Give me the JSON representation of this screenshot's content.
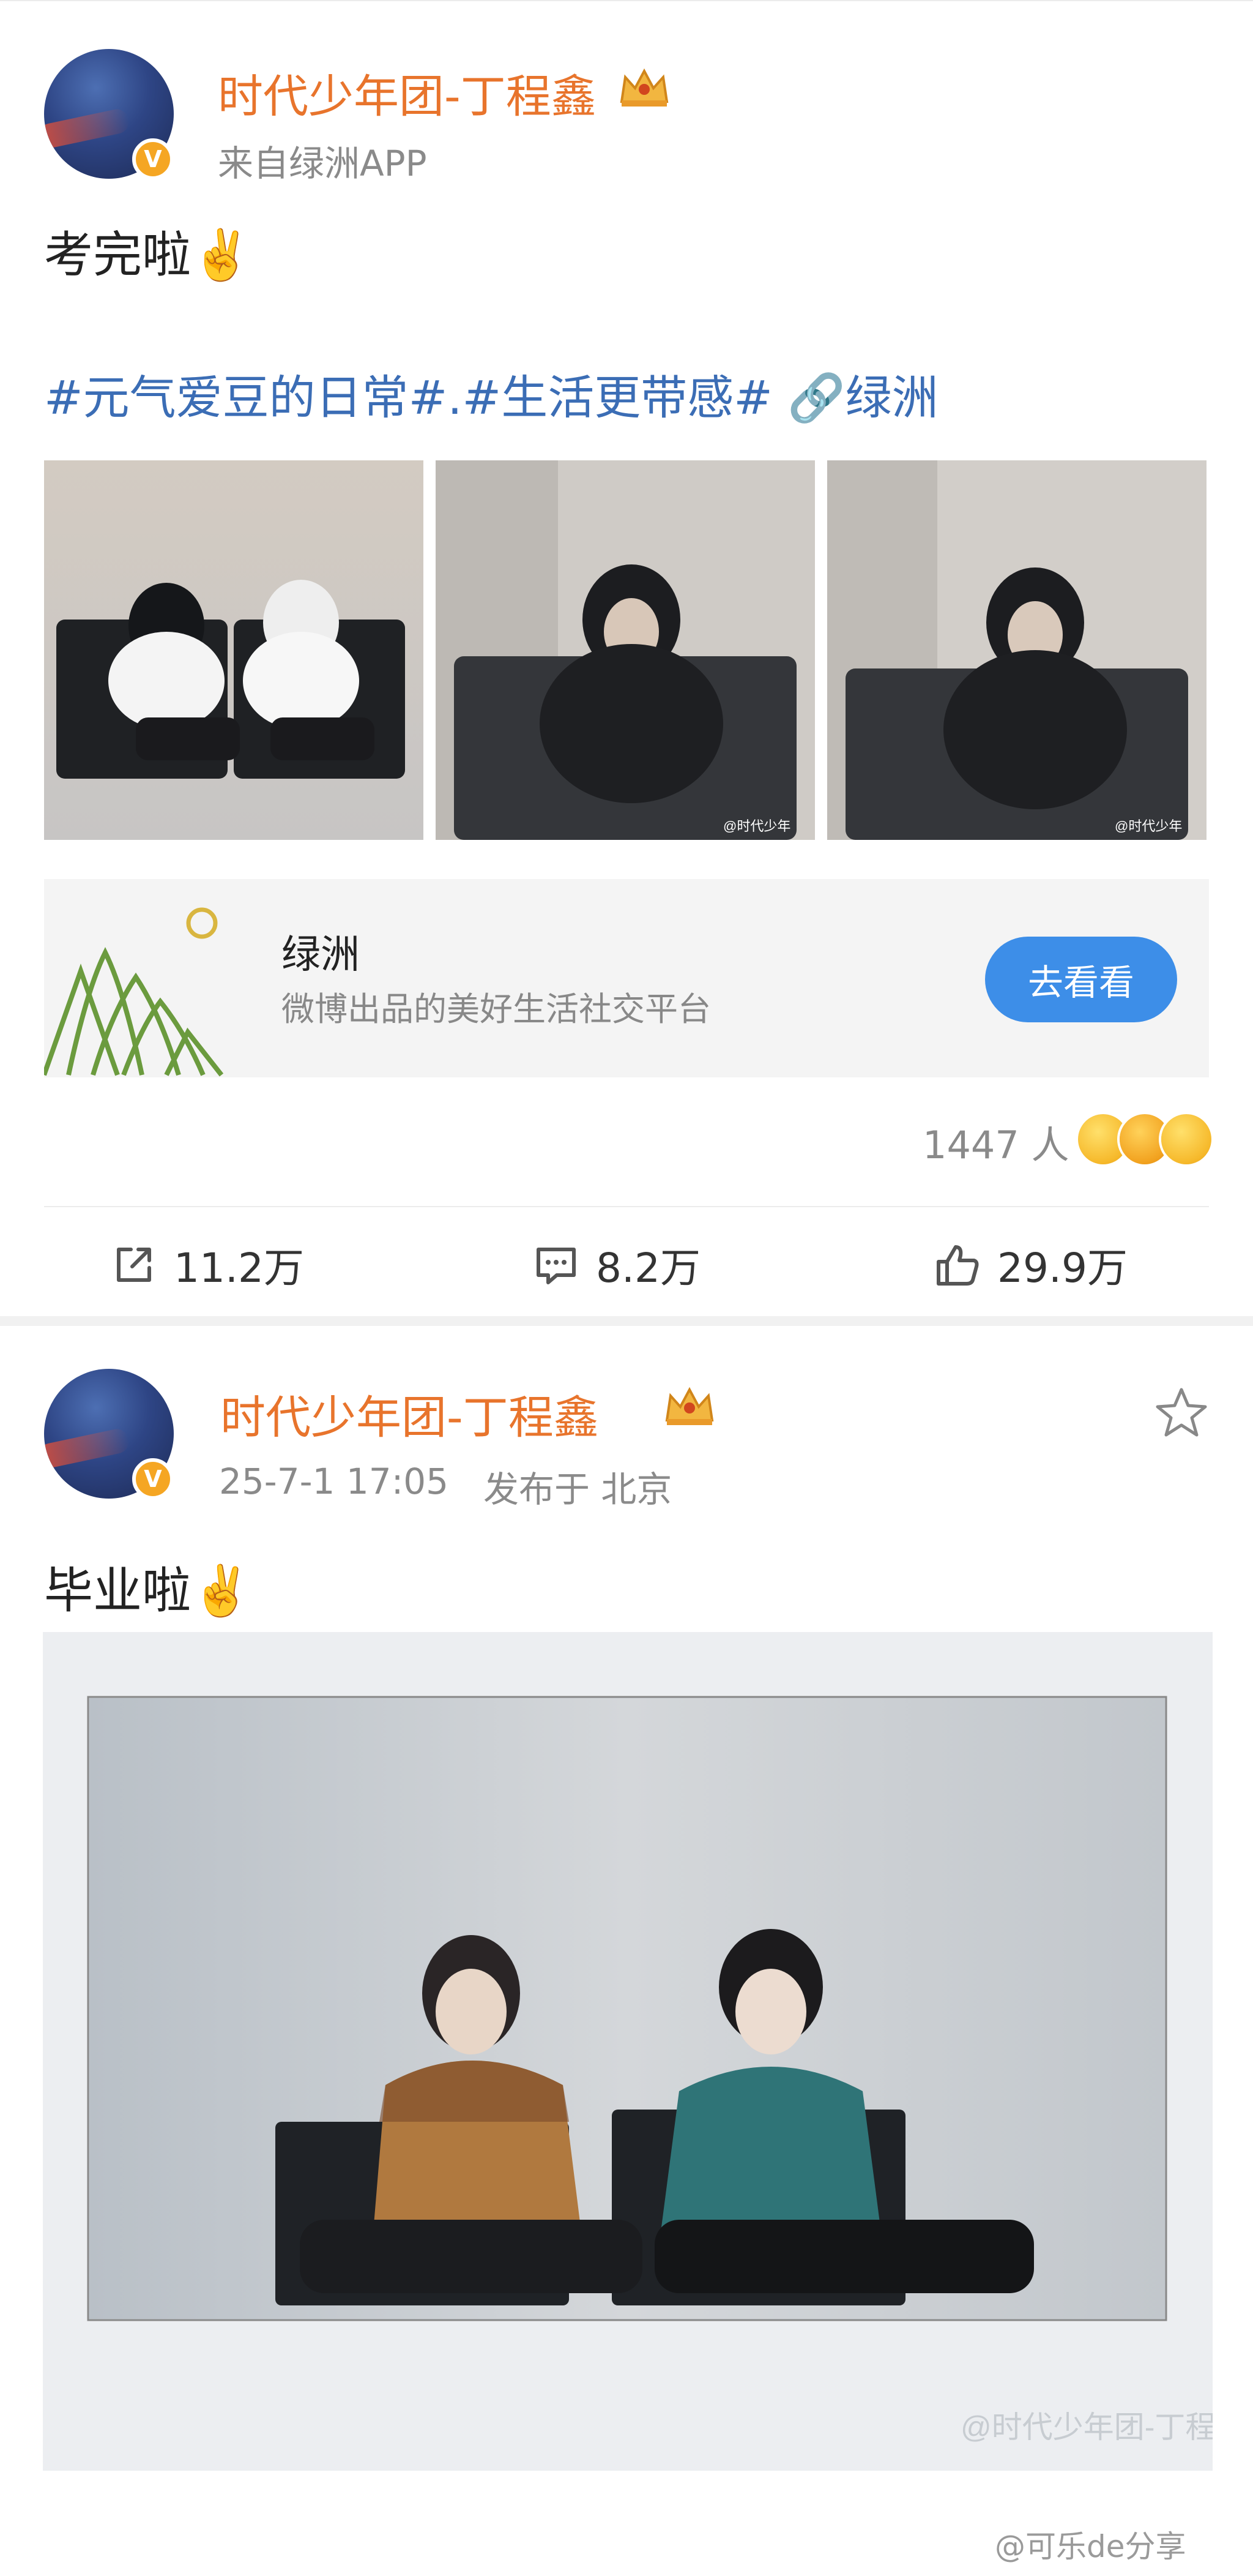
{
  "post1": {
    "username": "时代少年团-丁程鑫",
    "source": "来自绿洲APP",
    "text": "考完啦✌️",
    "topics": "#元气爱豆的日常#.#生活更带感# 🔗绿洲",
    "photo_watermark": "@时代少年",
    "card": {
      "title": "绿洲",
      "subtitle": "微博出品的美好生活社交平台",
      "button": "去看看"
    },
    "reactions": "1447 人",
    "actions": {
      "repost": "11.2万",
      "comment": "8.2万",
      "like": "29.9万"
    }
  },
  "post2": {
    "username": "时代少年团-丁程鑫",
    "timestamp": "25-7-1 17:05",
    "location": "发布于 北京",
    "text": "毕业啦✌️",
    "photo_watermark": "@时代少年团-丁程鑫"
  },
  "footer_watermark": "@可乐de分享",
  "colors": {
    "username": "#e8742c",
    "topic": "#3b6db5",
    "button": "#3d8ee8"
  }
}
